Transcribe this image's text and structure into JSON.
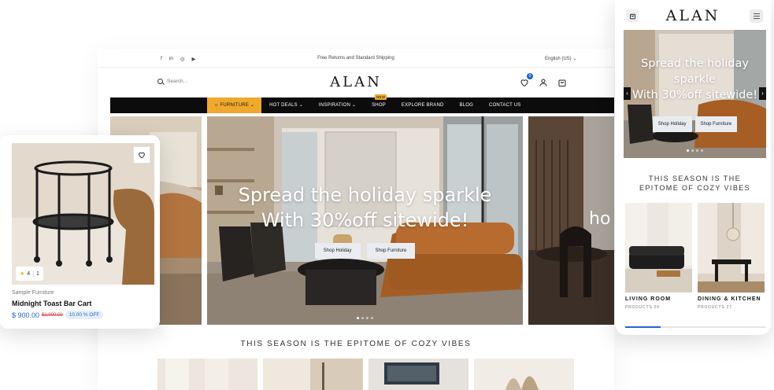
{
  "desktop": {
    "topbar": {
      "social": [
        "f",
        "in",
        "◎",
        "▶"
      ],
      "promo": "Free Returns and Standard Shipping",
      "language": "English (US) ⌄"
    },
    "header": {
      "search_placeholder": "Search...",
      "logo": "ALAN",
      "wishlist_count": "0"
    },
    "nav": {
      "items": [
        {
          "label": "☼ FURNITURE ⌄"
        },
        {
          "label": "HOT DEALS ⌄"
        },
        {
          "label": "INSPIRATION ⌄"
        },
        {
          "label": "SHOP"
        },
        {
          "label": "EXPLORE BRAND"
        },
        {
          "label": "BLOG"
        },
        {
          "label": "CONTACT US"
        }
      ],
      "shop_badge": "NEW"
    },
    "hero": {
      "title_line1": "Spread the holiday sparkle",
      "title_line2": "With 30%off sitewide!",
      "buttons": {
        "holiday": "Shop Holiday",
        "furniture": "Shop Furniture"
      },
      "right_peek_text": "ho"
    },
    "section_title": "THIS SEASON IS THE EPITOME OF COZY VIBES"
  },
  "product_card": {
    "rating": "4",
    "reviews": "1",
    "category": "Sample Furniture",
    "name": "Midnight Toast Bar Cart",
    "price": "$ 900.00",
    "old_price": "$1,000.00",
    "discount": "10.00 % OFF"
  },
  "mobile": {
    "logo": "ALAN",
    "hero": {
      "title_line1": "Spread the holiday",
      "title_line2": "sparkle",
      "title_line3": "With 30%off sitewide!",
      "buttons": {
        "holiday": "Shop Holiday",
        "furniture": "Shop Furniture"
      }
    },
    "section_title_line1": "THIS SEASON IS THE",
    "section_title_line2": "EPITOME OF COZY VIBES",
    "categories": [
      {
        "name": "LIVING ROOM",
        "count": "PRODUCTS 26"
      },
      {
        "name": "DINING & KITCHEN",
        "count": "PRODUCTS 27"
      }
    ],
    "carousel_progress": 0.25
  },
  "colors": {
    "accent_blue": "#1f66d1",
    "nav_highlight": "#f0a92c",
    "nav_bg": "#0c0c0c",
    "discount_red": "#d33333"
  }
}
